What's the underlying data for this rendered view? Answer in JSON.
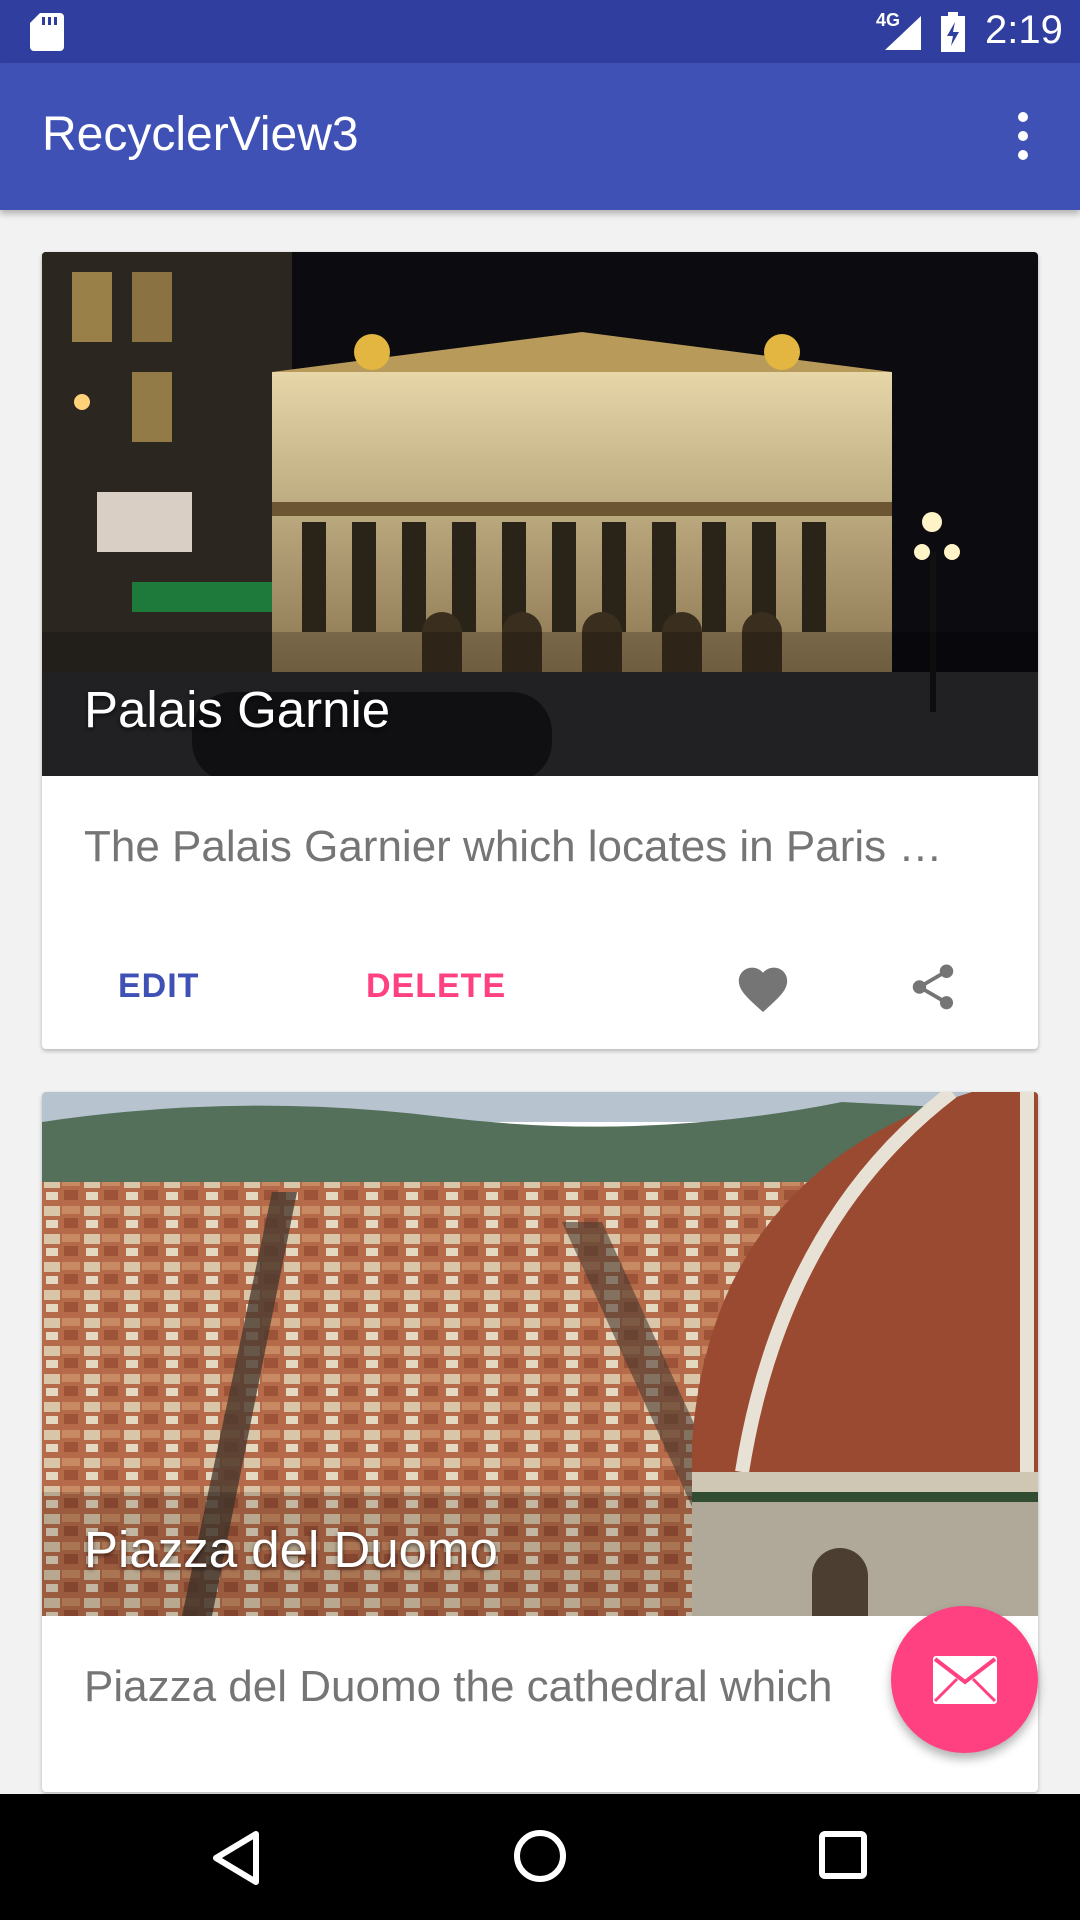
{
  "status_bar": {
    "time": "2:19",
    "network": "4G",
    "icons": [
      "sd-card-icon",
      "signal-icon",
      "battery-icon"
    ]
  },
  "app_bar": {
    "title": "RecyclerView3",
    "menu_icon": "overflow-menu-icon"
  },
  "cards": [
    {
      "title": "Palais Garnie",
      "description": "The Palais Garnier which locates in Paris …",
      "edit_label": "EDIT",
      "delete_label": "DELETE",
      "favorite_icon": "heart-icon",
      "share_icon": "share-icon"
    },
    {
      "title": "Piazza del Duomo",
      "description": "Piazza del Duomo the cathedral which"
    }
  ],
  "fab": {
    "icon": "email-icon"
  },
  "nav_bar": {
    "icons": [
      "back-icon",
      "home-icon",
      "recents-icon"
    ]
  },
  "colors": {
    "primary": "#3f51b5",
    "primary_dark": "#303f9f",
    "accent": "#ff4081",
    "description_text": "#757575"
  }
}
